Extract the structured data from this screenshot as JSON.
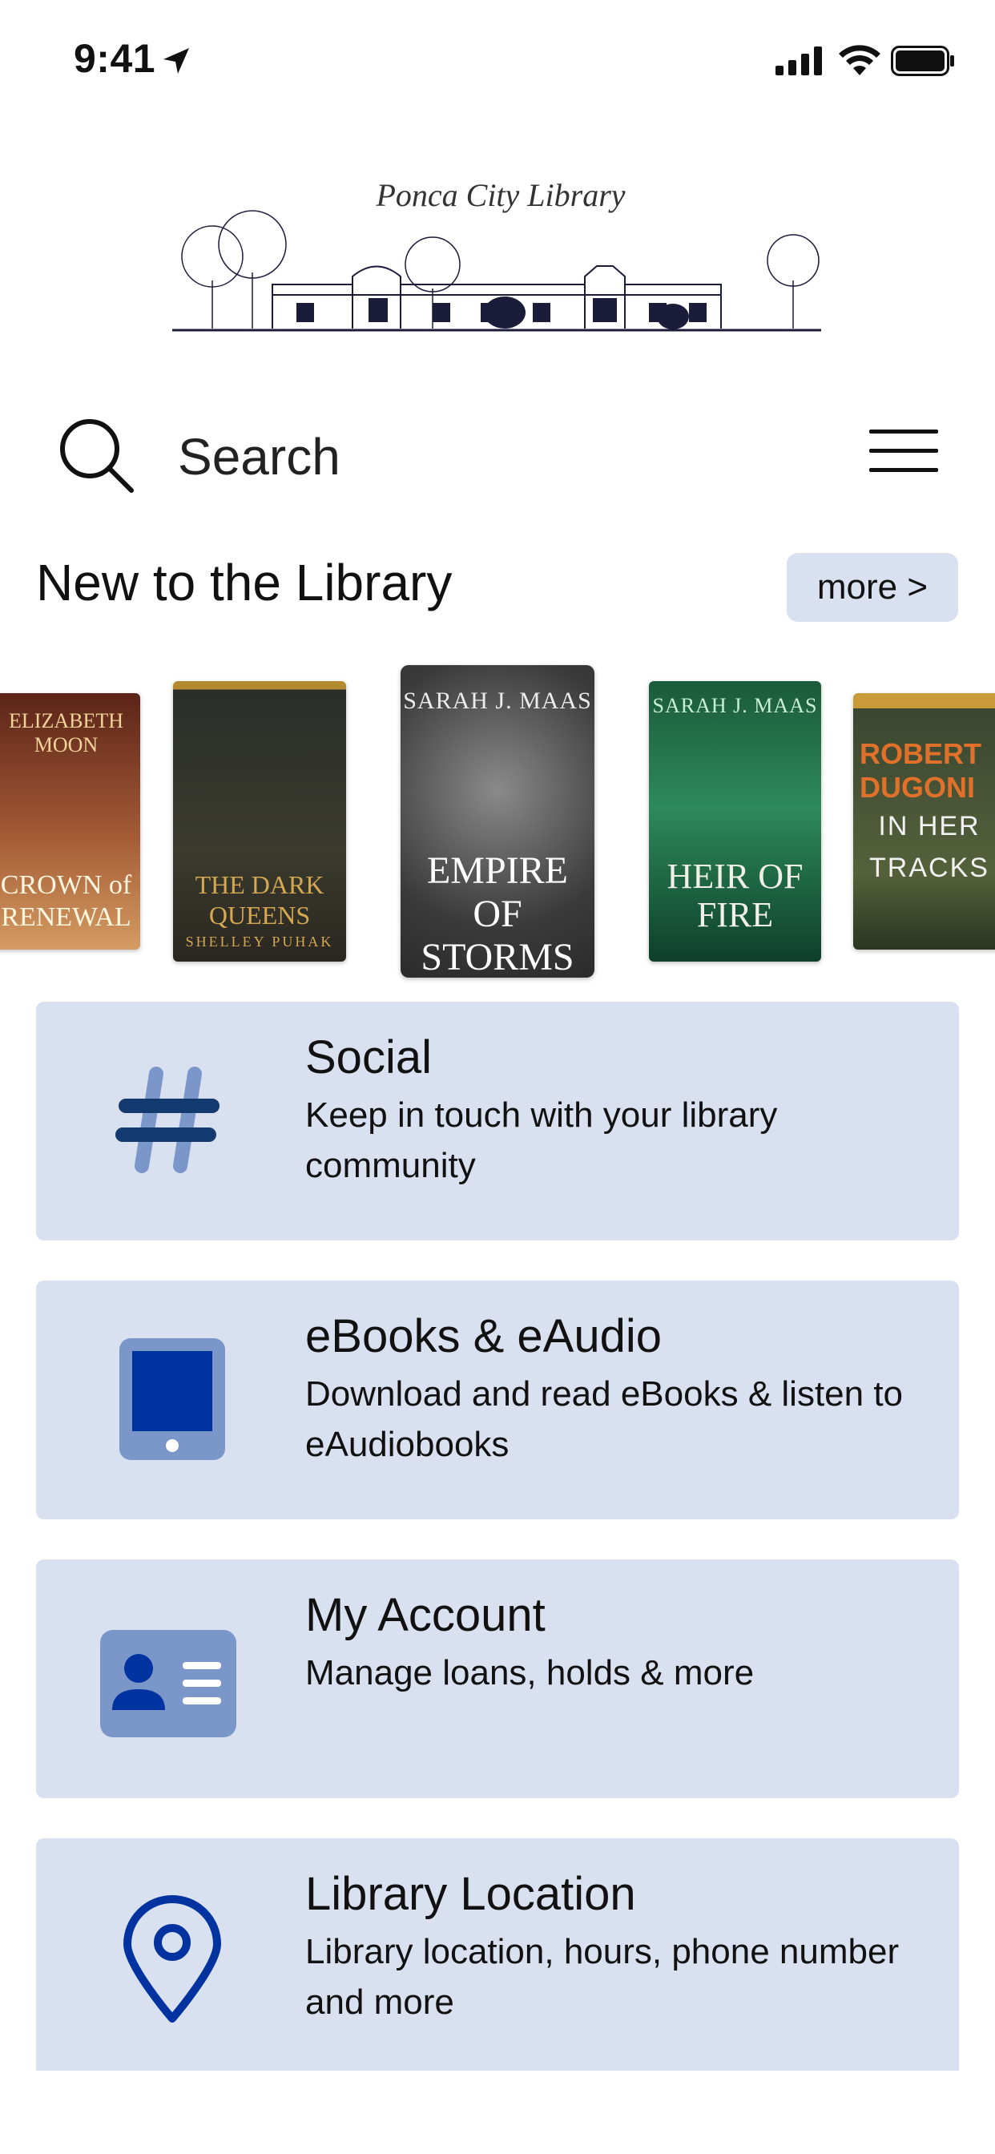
{
  "status_bar": {
    "time": "9:41"
  },
  "logo": {
    "title": "Ponca City Library"
  },
  "search": {
    "placeholder": "Search"
  },
  "new_section": {
    "title": "New to the Library",
    "more_label": "more >"
  },
  "covers": [
    {
      "author": "ELIZABETH MOON",
      "title": "CROWN of RENEWAL",
      "colors": [
        "#7a2e1e",
        "#c8843f"
      ]
    },
    {
      "author": "SHELLEY PUHAK",
      "title": "THE DARK QUEENS",
      "colors": [
        "#2a2f2a",
        "#b98a3a"
      ]
    },
    {
      "author": "SARAH J. MAAS",
      "title": "EMPIRE OF STORMS",
      "colors": [
        "#3a3a3a",
        "#6d6d6d"
      ]
    },
    {
      "author": "SARAH J. MAAS",
      "title": "HEIR OF FIRE",
      "colors": [
        "#0f4a32",
        "#1d7a55"
      ]
    },
    {
      "author": "ROBERT DUGONI",
      "title": "IN HER TRACKS",
      "colors": [
        "#3a4a2c",
        "#5a6a3c"
      ]
    }
  ],
  "menu": [
    {
      "title": "Social",
      "description": "Keep in touch with your library community",
      "icon": "hashtag-icon"
    },
    {
      "title": "eBooks & eAudio",
      "description": "Download and read eBooks & listen to eAudiobooks",
      "icon": "tablet-icon"
    },
    {
      "title": "My Account",
      "description": "Manage loans, holds & more",
      "icon": "id-card-icon"
    },
    {
      "title": "Library Location",
      "description": "Library location, hours, phone number and more",
      "icon": "map-pin-icon"
    }
  ],
  "colors": {
    "card_bg": "#d9e1f0",
    "icon_dark": "#0033a0",
    "icon_light": "#7b97c9",
    "hash_dark": "#123a6e",
    "hash_light": "#7b97c9"
  }
}
